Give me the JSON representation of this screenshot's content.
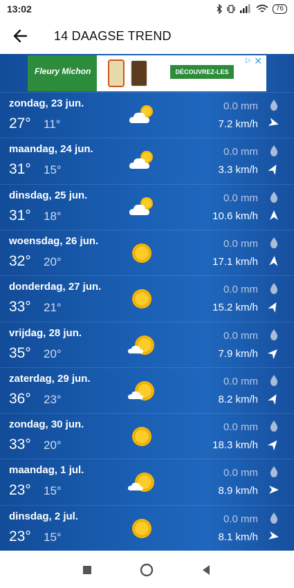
{
  "status": {
    "time": "13:02",
    "battery": "76"
  },
  "header": {
    "title": "14 DAAGSE TREND"
  },
  "ad": {
    "brand": "Fleury Michon",
    "cta": "DÉCOUVREZ-LES"
  },
  "days": [
    {
      "name": "zondag, 23 jun.",
      "high": "27°",
      "low": "11°",
      "icon": "partly-cloudy-icon",
      "precip": "0.0 mm",
      "wind": "7.2 km/h",
      "wind_dir_deg": 105
    },
    {
      "name": "maandag, 24 jun.",
      "high": "31°",
      "low": "15°",
      "icon": "partly-cloudy-icon",
      "precip": "0.0 mm",
      "wind": "3.3 km/h",
      "wind_dir_deg": 30
    },
    {
      "name": "dinsdag, 25 jun.",
      "high": "31°",
      "low": "18°",
      "icon": "partly-cloudy-icon",
      "precip": "0.0 mm",
      "wind": "10.6 km/h",
      "wind_dir_deg": 0
    },
    {
      "name": "woensdag, 26 jun.",
      "high": "32°",
      "low": "20°",
      "icon": "sun-icon",
      "precip": "0.0 mm",
      "wind": "17.1 km/h",
      "wind_dir_deg": 5
    },
    {
      "name": "donderdag, 27 jun.",
      "high": "33°",
      "low": "21°",
      "icon": "sun-icon",
      "precip": "0.0 mm",
      "wind": "15.2 km/h",
      "wind_dir_deg": 30
    },
    {
      "name": "vrijdag, 28 jun.",
      "high": "35°",
      "low": "20°",
      "icon": "sun-small-cloud-icon",
      "precip": "0.0 mm",
      "wind": "7.9 km/h",
      "wind_dir_deg": 45
    },
    {
      "name": "zaterdag, 29 jun.",
      "high": "36°",
      "low": "23°",
      "icon": "sun-small-cloud-icon",
      "precip": "0.0 mm",
      "wind": "8.2 km/h",
      "wind_dir_deg": 30
    },
    {
      "name": "zondag, 30 jun.",
      "high": "33°",
      "low": "20°",
      "icon": "sun-icon",
      "precip": "0.0 mm",
      "wind": "18.3 km/h",
      "wind_dir_deg": 40
    },
    {
      "name": "maandag, 1 jul.",
      "high": "23°",
      "low": "15°",
      "icon": "sun-small-cloud-icon",
      "precip": "0.0 mm",
      "wind": "8.9 km/h",
      "wind_dir_deg": 90
    },
    {
      "name": "dinsdag, 2 jul.",
      "high": "23°",
      "low": "15°",
      "icon": "sun-icon",
      "precip": "0.0 mm",
      "wind": "8.1 km/h",
      "wind_dir_deg": 100
    }
  ],
  "colors": {
    "sun": "#f8b500",
    "sun_inner": "#fccd2a",
    "cloud": "#ffffff",
    "background": "#1a5fb3"
  }
}
